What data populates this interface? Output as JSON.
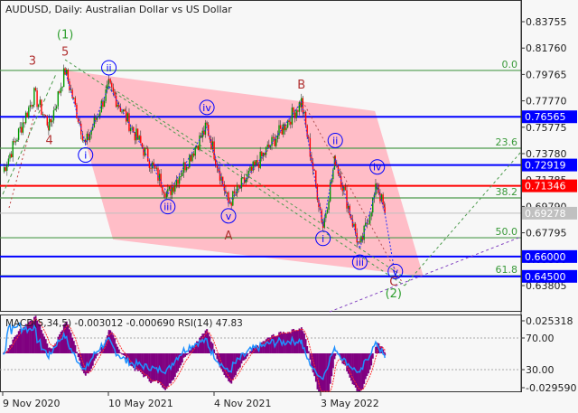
{
  "chart_title": "AUDUSD, Daily:  Australian Dollar vs US Dollar",
  "chart_data": [
    {
      "type": "line",
      "title": "AUDUSD, Daily:  Australian Dollar vs US Dollar",
      "x_ticks": [
        "9 Nov 2020",
        "10 May 2021",
        "4 Nov 2021",
        "3 May 2022"
      ],
      "y_ticks": [
        "0.83755",
        "0.81760",
        "0.79765",
        "0.77770",
        "0.75775",
        "0.73780",
        "0.71785",
        "0.69790",
        "0.67795",
        "0.65800",
        "0.63805"
      ],
      "ylim": [
        0.629,
        0.854
      ],
      "price_path": [
        {
          "date": "2020-11-09",
          "price": 0.7241
        },
        {
          "date": "2021-01-02",
          "price": 0.7822
        },
        {
          "date": "2021-01-28",
          "price": 0.7583
        },
        {
          "date": "2021-02-24",
          "price": 0.8007
        },
        {
          "date": "2021-03-31",
          "price": 0.7447
        },
        {
          "date": "2021-05-10",
          "price": 0.789
        },
        {
          "date": "2021-08-19",
          "price": 0.707
        },
        {
          "date": "2021-10-25",
          "price": 0.758
        },
        {
          "date": "2021-12-01",
          "price": 0.7
        },
        {
          "date": "2022-04-05",
          "price": 0.777
        },
        {
          "date": "2022-05-12",
          "price": 0.683
        },
        {
          "date": "2022-06-02",
          "price": 0.734
        },
        {
          "date": "2022-07-14",
          "price": 0.666
        },
        {
          "date": "2022-08-13",
          "price": 0.714
        },
        {
          "date": "2022-08-26",
          "price": 0.6928
        }
      ],
      "horizontal_levels": [
        {
          "price": 0.76565,
          "label": "0.76565",
          "color": "#0000ff"
        },
        {
          "price": 0.72919,
          "label": "0.72919",
          "color": "#0000ff"
        },
        {
          "price": 0.71346,
          "label": "0.71346",
          "color": "#ff0000"
        },
        {
          "price": 0.69278,
          "label": "0.69278",
          "color": "#c0c0c0"
        },
        {
          "price": 0.66,
          "label": "0.66000",
          "color": "#0000ff"
        },
        {
          "price": 0.645,
          "label": "0.64500",
          "color": "#0000ff"
        }
      ],
      "fibonacci_levels": [
        {
          "label": "0.0",
          "price": 0.8007
        },
        {
          "label": "23.6",
          "price": 0.7419
        },
        {
          "label": "38.2",
          "price": 0.7043
        },
        {
          "label": "50.0",
          "price": 0.6742
        },
        {
          "label": "61.8",
          "price": 0.6455
        }
      ],
      "channel": [
        {
          "date": "2021-02-24",
          "price": 0.8007
        },
        {
          "date": "2022-08-09",
          "price": 0.77
        },
        {
          "date": "2022-10-31",
          "price": 0.645
        },
        {
          "date": "2021-05-17",
          "price": 0.673
        }
      ],
      "wave_labels": [
        {
          "text": "(1)",
          "date": "2021-02-24",
          "price": 0.825,
          "color": "#2e9e2e"
        },
        {
          "text": "5",
          "date": "2021-02-24",
          "price": 0.812,
          "color": "#b03030"
        },
        {
          "text": "3",
          "date": "2020-12-30",
          "price": 0.805,
          "color": "#b03030"
        },
        {
          "text": "4",
          "date": "2021-01-28",
          "price": 0.745,
          "color": "#b03030"
        },
        {
          "text": "i",
          "date": "2021-03-31",
          "price": 0.734,
          "color": "#0000ff",
          "circled": true
        },
        {
          "text": "ii",
          "date": "2021-05-10",
          "price": 0.8,
          "color": "#0000ff",
          "circled": true
        },
        {
          "text": "iii",
          "date": "2021-08-19",
          "price": 0.695,
          "color": "#0000ff",
          "circled": true
        },
        {
          "text": "iv",
          "date": "2021-10-25",
          "price": 0.77,
          "color": "#0000ff",
          "circled": true
        },
        {
          "text": "v",
          "date": "2021-12-01",
          "price": 0.688,
          "color": "#0000ff",
          "circled": true
        },
        {
          "text": "A",
          "date": "2021-12-01",
          "price": 0.673,
          "color": "#b03030"
        },
        {
          "text": "B",
          "date": "2022-04-05",
          "price": 0.787,
          "color": "#b03030"
        },
        {
          "text": "i",
          "date": "2022-05-12",
          "price": 0.671,
          "color": "#0000ff",
          "circled": true
        },
        {
          "text": "ii",
          "date": "2022-06-02",
          "price": 0.745,
          "color": "#0000ff",
          "circled": true
        },
        {
          "text": "iii",
          "date": "2022-07-14",
          "price": 0.653,
          "color": "#0000ff",
          "circled": true
        },
        {
          "text": "iv",
          "date": "2022-08-13",
          "price": 0.725,
          "color": "#0000ff",
          "circled": true
        },
        {
          "text": "v",
          "date": "2022-09-13",
          "price": 0.646,
          "color": "#0000ff",
          "circled": true
        },
        {
          "text": "C",
          "date": "2022-09-10",
          "price": 0.638,
          "color": "#b03030"
        },
        {
          "text": "(2)",
          "date": "2022-09-10",
          "price": 0.629,
          "color": "#2e9e2e"
        }
      ]
    },
    {
      "type": "bar",
      "title": "MACD(5,34,5) -0.003012 -0.000690 RSI(14) 47.83",
      "y_ticks": [
        "0.025318",
        "70.00",
        "30.00",
        "-0.029590"
      ],
      "ylim": [
        -0.02959,
        0.025318
      ],
      "rsi_levels": [
        70,
        30
      ],
      "series": [
        {
          "name": "MACD(5,34,5)",
          "color": "#800080"
        },
        {
          "name": "RSI(14)",
          "color": "#1e90ff"
        }
      ]
    }
  ],
  "colors": {
    "bull": "#009900",
    "bear": "#ff0000",
    "channel": "#ffb6c1",
    "fib": "#4c9a4c"
  }
}
